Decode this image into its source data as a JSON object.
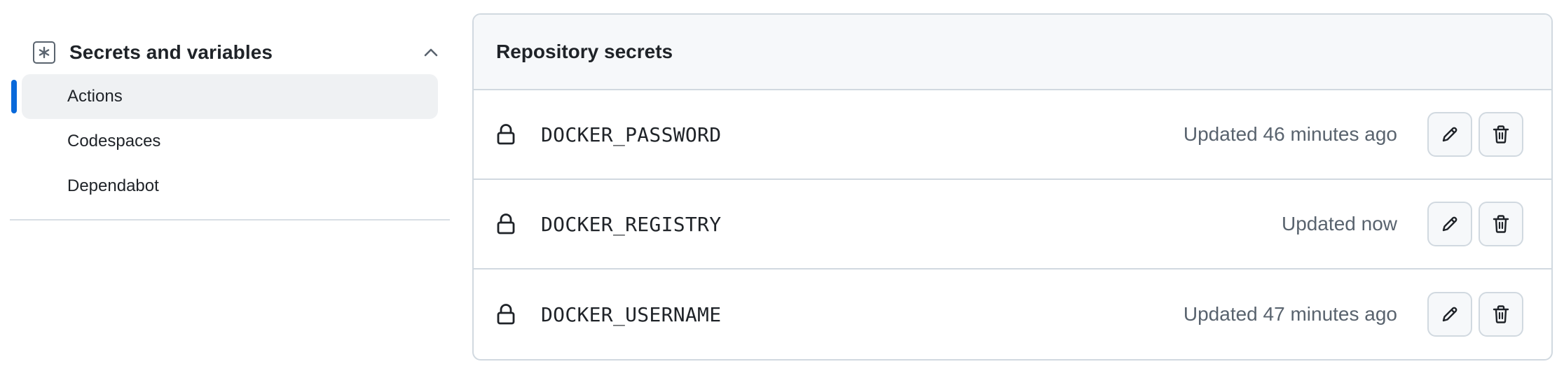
{
  "sidebar": {
    "section": {
      "title": "Secrets and variables",
      "icon": "asterisk-box-icon",
      "expanded": true
    },
    "items": [
      {
        "label": "Actions",
        "active": true
      },
      {
        "label": "Codespaces",
        "active": false
      },
      {
        "label": "Dependabot",
        "active": false
      }
    ]
  },
  "panel": {
    "title": "Repository secrets",
    "secrets": [
      {
        "name": "DOCKER_PASSWORD",
        "updated": "Updated 46 minutes ago"
      },
      {
        "name": "DOCKER_REGISTRY",
        "updated": "Updated now"
      },
      {
        "name": "DOCKER_USERNAME",
        "updated": "Updated 47 minutes ago"
      }
    ]
  },
  "colors": {
    "accent": "#0969da",
    "text": "#1f2328",
    "muted": "#59636e",
    "border": "#d1d9e0",
    "header_bg": "#f6f8fa",
    "active_bg": "#eff1f3"
  }
}
